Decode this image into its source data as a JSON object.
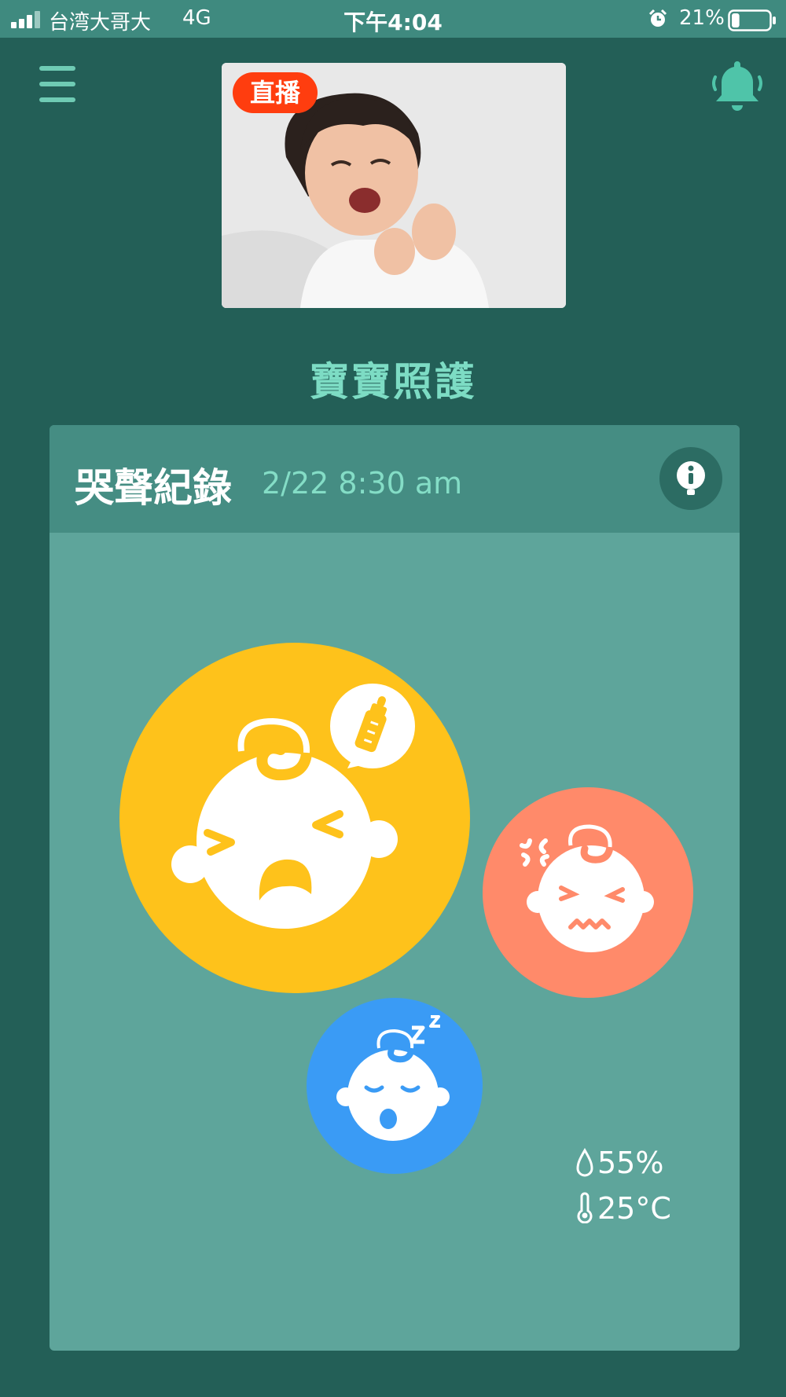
{
  "status_bar": {
    "carrier": "台湾大哥大",
    "network": "4G",
    "time": "下午4:04",
    "battery_pct": "21%",
    "battery_level": 0.21
  },
  "header": {
    "menu_icon": "hamburger-menu-icon",
    "bell_icon": "bell-icon",
    "live_badge": "直播"
  },
  "page_title": "寶寶照護",
  "card": {
    "title": "哭聲紀錄",
    "date": "2/22 8:30 am",
    "info_icon": "info-icon",
    "bubbles": [
      {
        "mood": "hungry",
        "icon": "hungry-baby-icon",
        "color": "#fec21b"
      },
      {
        "mood": "angry",
        "icon": "angry-baby-icon",
        "color": "#ff8a6a"
      },
      {
        "mood": "sleepy",
        "icon": "sleepy-baby-icon",
        "color": "#3a9bf5"
      }
    ],
    "humidity": "55%",
    "temperature": "25°C"
  },
  "colors": {
    "background": "#235f57",
    "accent": "#7ddcc4",
    "live": "#ff3d0f"
  }
}
